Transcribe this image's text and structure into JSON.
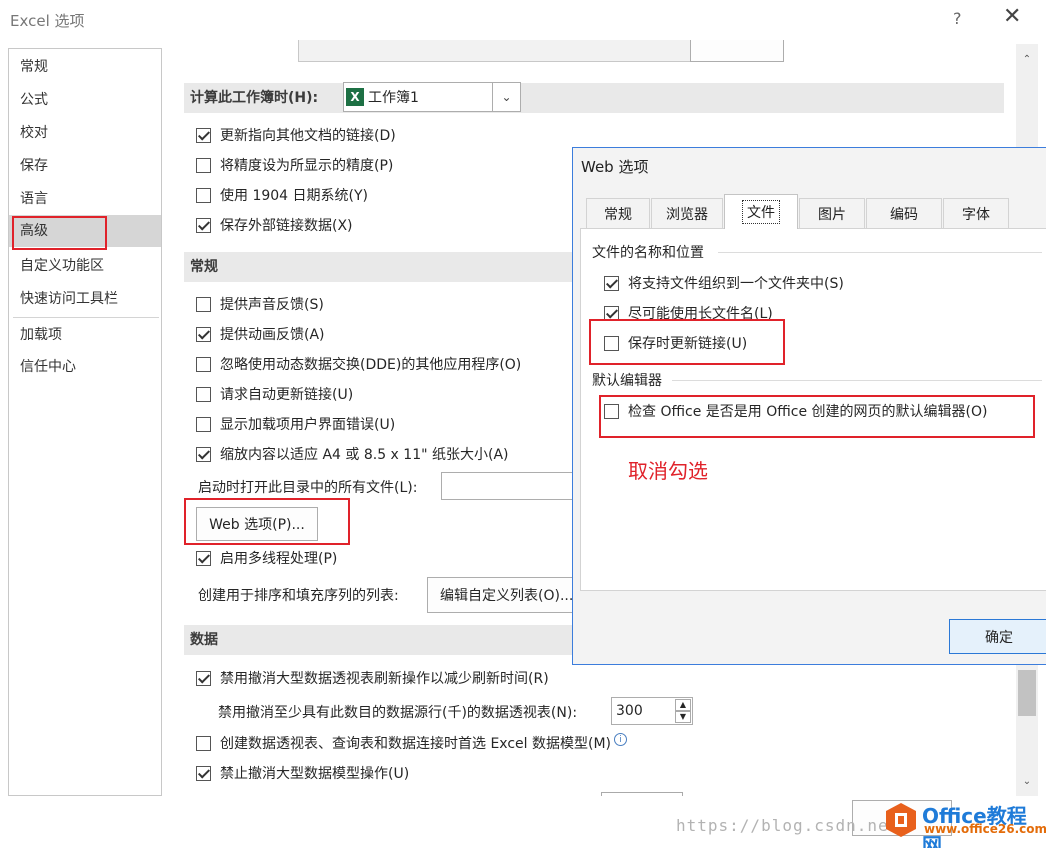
{
  "window": {
    "title": "Excel 选项",
    "help": "?",
    "close": "✕"
  },
  "nav": [
    "常规",
    "公式",
    "校对",
    "保存",
    "语言",
    "高级",
    "自定义功能区",
    "快速访问工具栏",
    "加载项",
    "信任中心"
  ],
  "workbook_calc": {
    "label": "计算此工作簿时(H):",
    "selected": "工作簿1"
  },
  "wb_options": [
    {
      "label": "更新指向其他文档的链接(D)",
      "checked": true
    },
    {
      "label": "将精度设为所显示的精度(P)",
      "checked": false
    },
    {
      "label": "使用 1904 日期系统(Y)",
      "checked": false
    },
    {
      "label": "保存外部链接数据(X)",
      "checked": true
    }
  ],
  "general": {
    "header": "常规",
    "options": [
      {
        "label": "提供声音反馈(S)",
        "checked": false
      },
      {
        "label": "提供动画反馈(A)",
        "checked": true
      },
      {
        "label": "忽略使用动态数据交换(DDE)的其他应用程序(O)",
        "checked": false
      },
      {
        "label": "请求自动更新链接(U)",
        "checked": false
      },
      {
        "label": "显示加载项用户界面错误(U)",
        "checked": false
      },
      {
        "label": "缩放内容以适应 A4 或 8.5 x 11\" 纸张大小(A)",
        "checked": true
      }
    ],
    "startup_label": "启动时打开此目录中的所有文件(L):",
    "web_options_button": "Web 选项(P)...",
    "multithread": {
      "label": "启用多线程处理(P)",
      "checked": true
    },
    "sort_list_label": "创建用于排序和填充序列的列表:",
    "edit_list_button": "编辑自定义列表(O)..."
  },
  "data": {
    "header": "数据",
    "opt1": {
      "label": "禁用撤消大型数据透视表刷新操作以减少刷新时间(R)",
      "checked": true
    },
    "rows_label": "禁用撤消至少具有此数目的数据源行(千)的数据透视表(N):",
    "rows_value": "300",
    "opt2": {
      "label": "创建数据透视表、查询表和数据连接时首选 Excel 数据模型(M)",
      "checked": false
    },
    "opt3": {
      "label": "禁止撤消大型数据模型操作(U)",
      "checked": true
    }
  },
  "dialog": {
    "title": "Web 选项",
    "tabs": [
      "常规",
      "浏览器",
      "文件",
      "图片",
      "编码",
      "字体"
    ],
    "active_tab": "文件",
    "group1": "文件的名称和位置",
    "g1_options": [
      {
        "label": "将支持文件组织到一个文件夹中(S)",
        "checked": true
      },
      {
        "label": "尽可能使用长文件名(L)",
        "checked": true
      },
      {
        "label": "保存时更新链接(U)",
        "checked": false
      }
    ],
    "group2": "默认编辑器",
    "g2_option": {
      "label": "检查 Office 是否是用 Office 创建的网页的默认编辑器(O)",
      "checked": false
    },
    "ok": "确定"
  },
  "annotation": "取消勾选",
  "watermark": "https://blog.csdn.net",
  "logo": {
    "name": "Office教程网",
    "url": "www.office26.com"
  },
  "colors": {
    "highlight": "#e0222a",
    "accent": "#2b78d6"
  }
}
